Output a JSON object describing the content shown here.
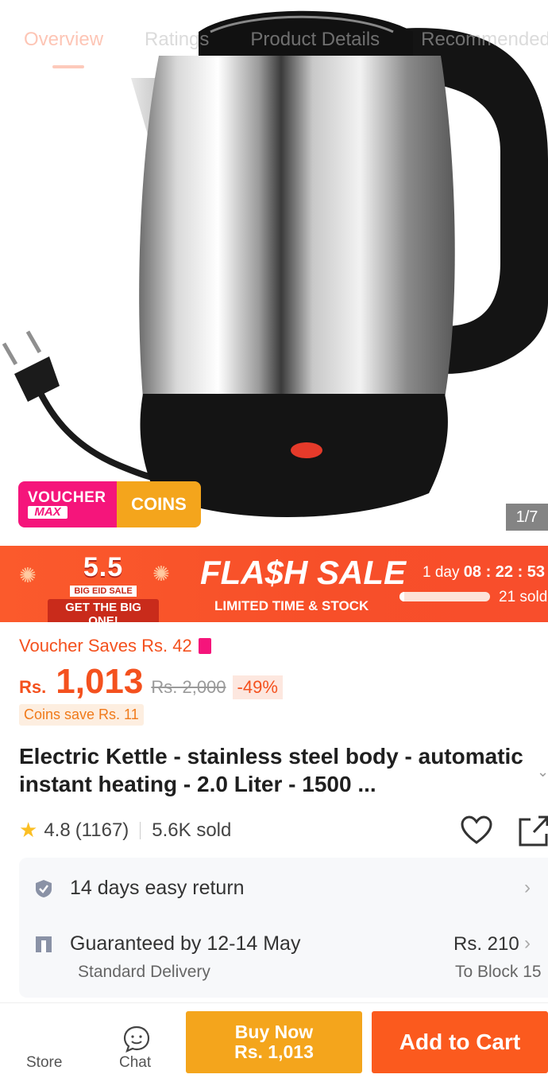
{
  "tabs": [
    "Overview",
    "Ratings",
    "Product Details",
    "Recommended"
  ],
  "active_tab": "Overview",
  "hero": {
    "voucher_badge": {
      "line1": "VOUCHER",
      "line2": "MAX",
      "coins": "COINS"
    },
    "image_counter": "1/7"
  },
  "flash_sale": {
    "event_date": "5.5",
    "event_name": "BIG EID SALE",
    "event_tagline": "GET THE BIG ONE!",
    "title": "FLA$H SALE",
    "subtitle": "LIMITED TIME & STOCK",
    "timer_days": "1 day",
    "timer_time": "08 : 22 : 53",
    "sold_label": "21 sold",
    "sold_progress": 0.05
  },
  "price": {
    "voucher_saves": "Voucher Saves Rs. 42",
    "currency": "Rs.",
    "amount": "1,013",
    "original": "Rs. 2,000",
    "discount": "-49%",
    "coins_save": "Coins save Rs. 11"
  },
  "product": {
    "title": "Electric Kettle - stainless steel body - automatic instant heating - 2.0 Liter - 1500 ...",
    "rating": "4.8",
    "review_count": "(1167)",
    "sold": "5.6K sold"
  },
  "service": {
    "returns": "14 days easy return",
    "delivery_guarantee": "Guaranteed by 12-14 May",
    "delivery_type": "Standard Delivery",
    "delivery_fee": "Rs. 210",
    "delivery_location": "To Block 15"
  },
  "bottom_bar": {
    "store": "Store",
    "chat": "Chat",
    "buy_now": "Buy Now",
    "buy_now_price": "Rs. 1,013",
    "add_to_cart": "Add to Cart"
  },
  "colors": {
    "accent": "#f4511e",
    "flash_bg": "#f9552a",
    "buy_now": "#f4a51c",
    "add_to_cart": "#fb5a1e",
    "voucher_pink": "#f5157b"
  }
}
